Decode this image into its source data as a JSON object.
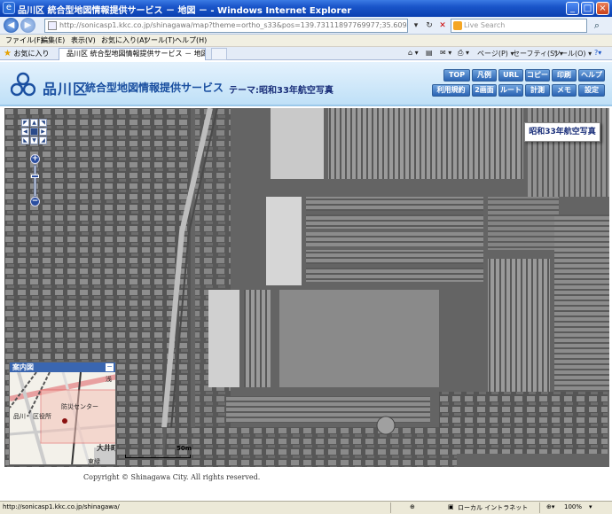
{
  "window": {
    "title": "品川区 統合型地図情報提供サービス － 地図 － - Windows Internet Explorer",
    "minimize": "_",
    "maximize": "□",
    "close": "×"
  },
  "addressbar": {
    "url": "http://sonicasp1.kkc.co.jp/shinagawa/map?theme=ortho_s33&pos=139.73111897769977;35.60944502929272",
    "search_placeholder": "Live Search",
    "back": "◀",
    "forward": "▶"
  },
  "menubar": {
    "items": [
      "ファイル(F)",
      "編集(E)",
      "表示(V)",
      "お気に入り(A)",
      "ツール(T)",
      "ヘルプ(H)"
    ]
  },
  "tabbar": {
    "favorites": "お気に入り",
    "tab_title": "品川区 統合型地図情報提供サービス － 地図 －",
    "commands": [
      "ページ(P) ▾",
      "セーフティ(S) ▾",
      "ツール(O) ▾"
    ]
  },
  "header": {
    "site_name": "品川区",
    "site_sub": "統合型地図情報提供サービス",
    "theme": "テーマ:昭和33年航空写真",
    "buttons_row1": [
      "TOP",
      "凡例",
      "URL",
      "コピー",
      "印刷",
      "ヘルプ"
    ],
    "buttons_row2": [
      "利用規約",
      "2画面",
      "ルート",
      "計測",
      "メモ",
      "設定"
    ]
  },
  "map": {
    "layer_label": "昭和33年航空写真",
    "scale_label": "50m",
    "zoom_in": "+",
    "zoom_out": "−"
  },
  "overview": {
    "title": "案内図",
    "minimize": "−",
    "labels": {
      "disaster_center": "防災センター",
      "ward_office": "区役所",
      "shinagawa": "品川",
      "oimachi": "大井町",
      "higashi_oi": "東緑",
      "asa": "浅"
    }
  },
  "footer": {
    "copyright": "Copyright © Shinagawa City. All rights reserved."
  },
  "statusbar": {
    "url": "http://sonicasp1.kkc.co.jp/shinagawa/",
    "zone": "ローカル イントラネット",
    "zoom": "100%"
  },
  "colors": {
    "title_bar": "#1a55c9",
    "header_text": "#1a4fa0",
    "header_button": "#2b64b3"
  }
}
